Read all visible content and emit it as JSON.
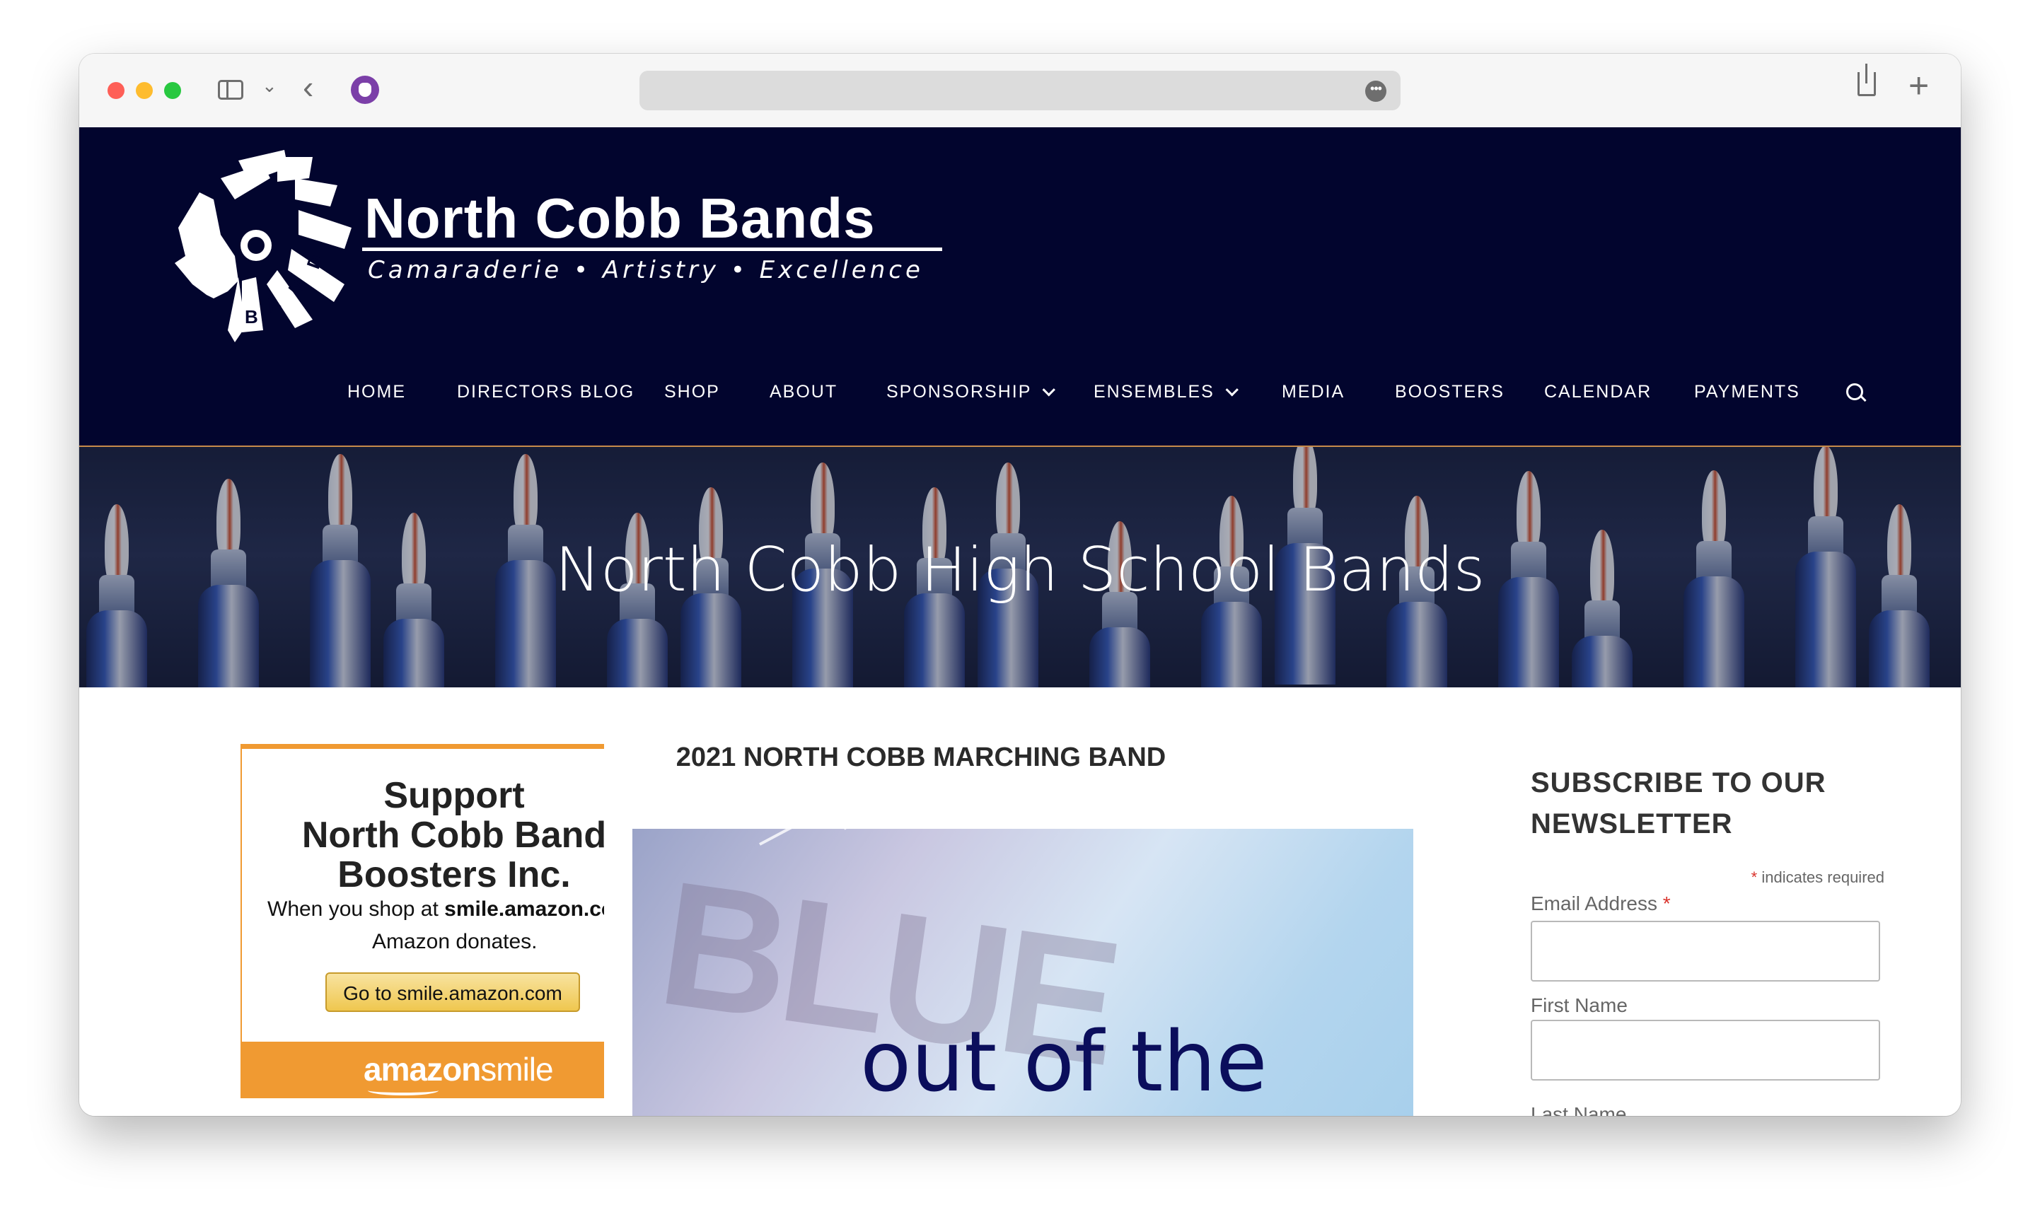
{
  "browser": {
    "more_label": "•••"
  },
  "site": {
    "title": "North Cobb Bands",
    "tagline": "Camaraderie • Artistry • Excellence",
    "logo_letters": "BAND"
  },
  "nav": {
    "items": [
      {
        "label": "HOME",
        "dropdown": false
      },
      {
        "label": "DIRECTORS BLOG",
        "dropdown": false
      },
      {
        "label": "SHOP",
        "dropdown": false
      },
      {
        "label": "ABOUT",
        "dropdown": false
      },
      {
        "label": "SPONSORSHIP",
        "dropdown": true
      },
      {
        "label": "ENSEMBLES",
        "dropdown": true
      },
      {
        "label": "MEDIA",
        "dropdown": false
      },
      {
        "label": "BOOSTERS",
        "dropdown": false
      },
      {
        "label": "CALENDAR",
        "dropdown": false
      },
      {
        "label": "PAYMENTS",
        "dropdown": false
      }
    ]
  },
  "hero": {
    "title": "North Cobb High School Bands"
  },
  "ad": {
    "line1": "Support",
    "line2": "North Cobb Band",
    "line3": "Boosters Inc.",
    "sub_prefix": "When you shop at ",
    "sub_domain": "smile.amazon.com,",
    "sub2": "Amazon donates.",
    "button": "Go to smile.amazon.com",
    "logo_bold": "amazon",
    "logo_light": "smile"
  },
  "main": {
    "heading": "2021 NORTH COBB MARCHING BAND",
    "video_bg_text": "BLUE",
    "video_text": "out of the"
  },
  "newsletter": {
    "title_line1": "SUBSCRIBE TO OUR",
    "title_line2": "NEWSLETTER",
    "required_star": "*",
    "required_note": " indicates required",
    "email_label": "Email Address",
    "first_name_label": "First Name",
    "last_name_label": "Last Name"
  },
  "colors": {
    "header_bg": "#02052e",
    "accent_orange": "#f09a32",
    "required_red": "#d9322b"
  }
}
